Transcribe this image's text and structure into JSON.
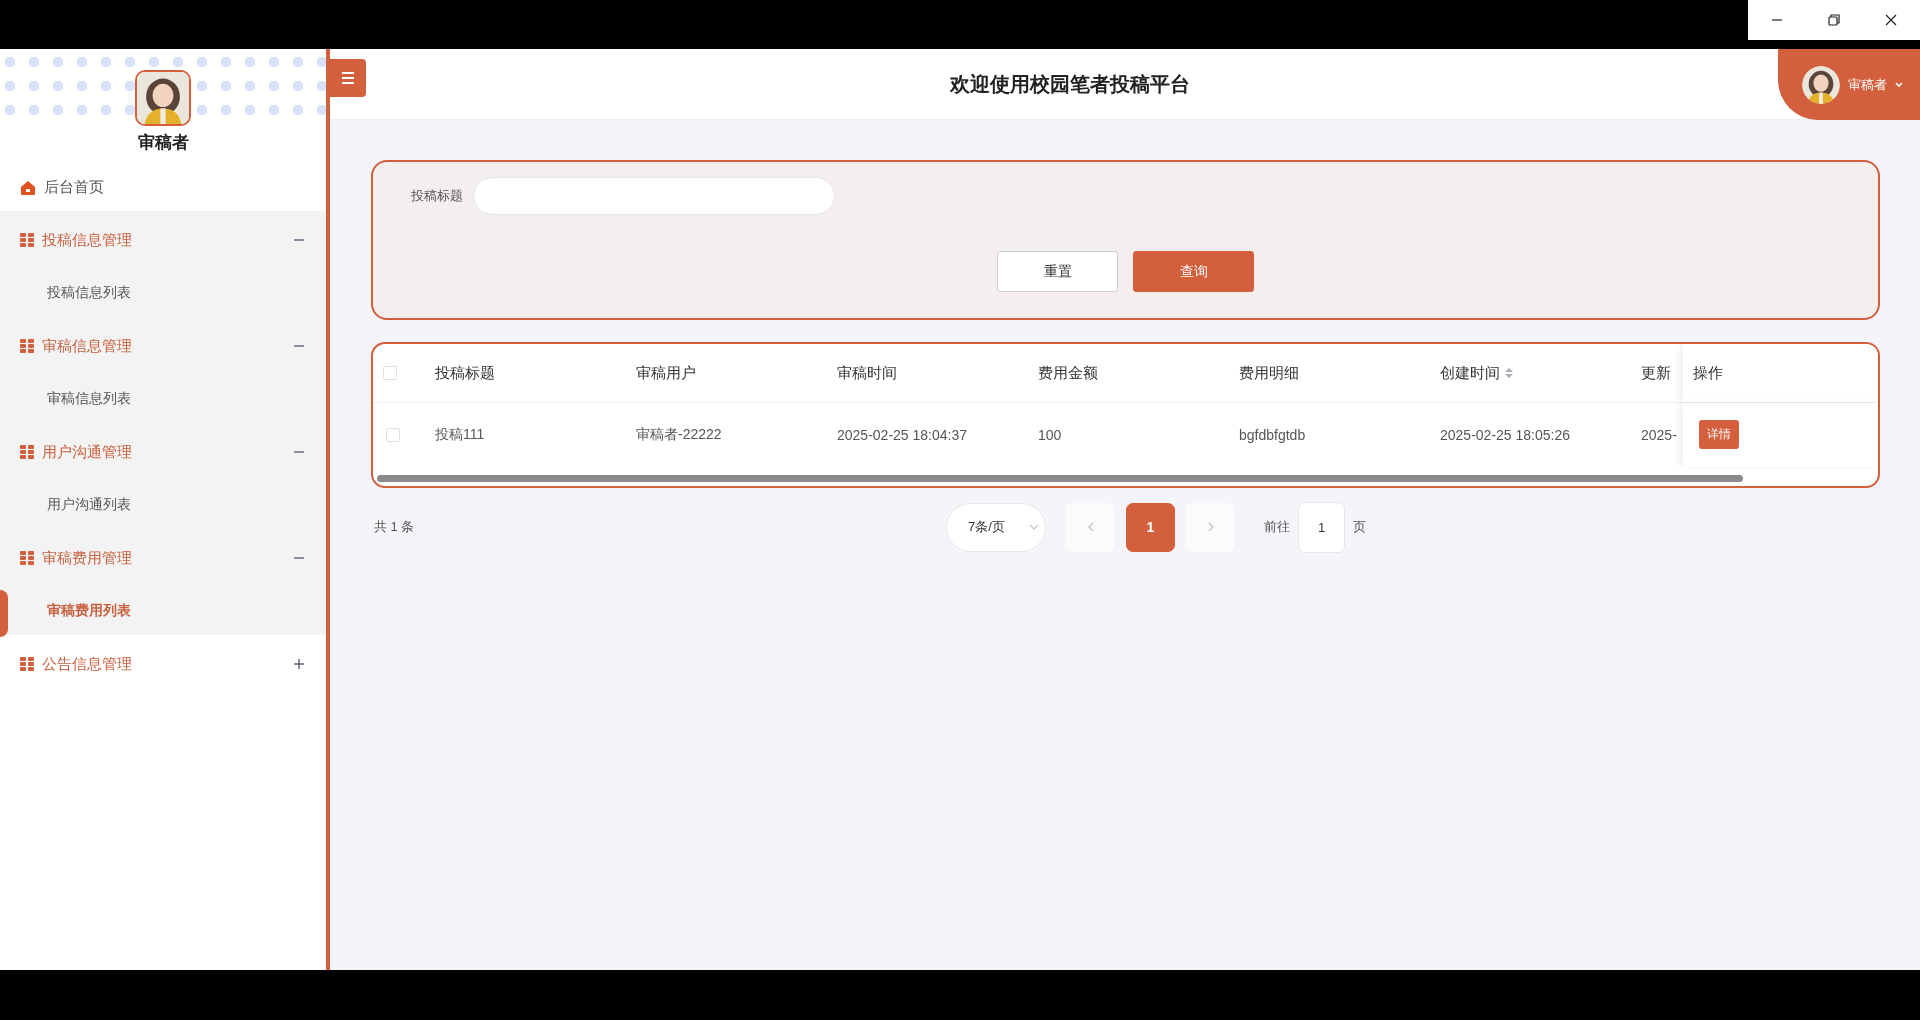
{
  "sidebar": {
    "user": "审稿者",
    "menu": [
      {
        "kind": "link",
        "label": "后台首页"
      },
      {
        "kind": "group",
        "label": "投稿信息管理",
        "expanded": true,
        "children": [
          {
            "label": "投稿信息列表",
            "selected": false
          }
        ]
      },
      {
        "kind": "group",
        "label": "审稿信息管理",
        "expanded": true,
        "children": [
          {
            "label": "审稿信息列表",
            "selected": false
          }
        ]
      },
      {
        "kind": "group",
        "label": "用户沟通管理",
        "expanded": true,
        "children": [
          {
            "label": "用户沟通列表",
            "selected": false
          }
        ]
      },
      {
        "kind": "group",
        "label": "审稿费用管理",
        "expanded": true,
        "children": [
          {
            "label": "审稿费用列表",
            "selected": true
          }
        ]
      },
      {
        "kind": "group",
        "label": "公告信息管理",
        "expanded": false
      }
    ]
  },
  "header": {
    "title": "欢迎使用校园笔者投稿平台",
    "user": "审稿者"
  },
  "search": {
    "fields": [
      {
        "label": "投稿标题"
      }
    ],
    "buttons": [
      {
        "label": "重置",
        "kind": "secondary"
      },
      {
        "label": "查询",
        "kind": "primary"
      }
    ]
  },
  "table": {
    "all_checked": false,
    "columns": [
      {
        "label": "投稿标题",
        "sortable": false
      },
      {
        "label": "审稿用户",
        "sortable": false
      },
      {
        "label": "审稿时间",
        "sortable": false
      },
      {
        "label": "费用金额",
        "sortable": false
      },
      {
        "label": "费用明细",
        "sortable": false
      },
      {
        "label": "创建时间",
        "sortable": true
      },
      {
        "label": "更新",
        "sortable": false
      }
    ],
    "action_column": "操作",
    "rows": [
      {
        "checked": false,
        "cells": [
          "投稿111",
          "审稿者-22222",
          "2025-02-25 18:04:37",
          "100",
          "bgfdbfgtdb",
          "2025-02-25 18:05:26",
          "2025-"
        ],
        "actions": [
          "详情"
        ]
      }
    ]
  },
  "pagination": {
    "total": "共 1 条",
    "page_size": "7条/页",
    "pages": [
      {
        "label": "1",
        "selected": true
      }
    ],
    "goto_label": "前往",
    "goto_value": "1",
    "goto_suffix": "页"
  }
}
